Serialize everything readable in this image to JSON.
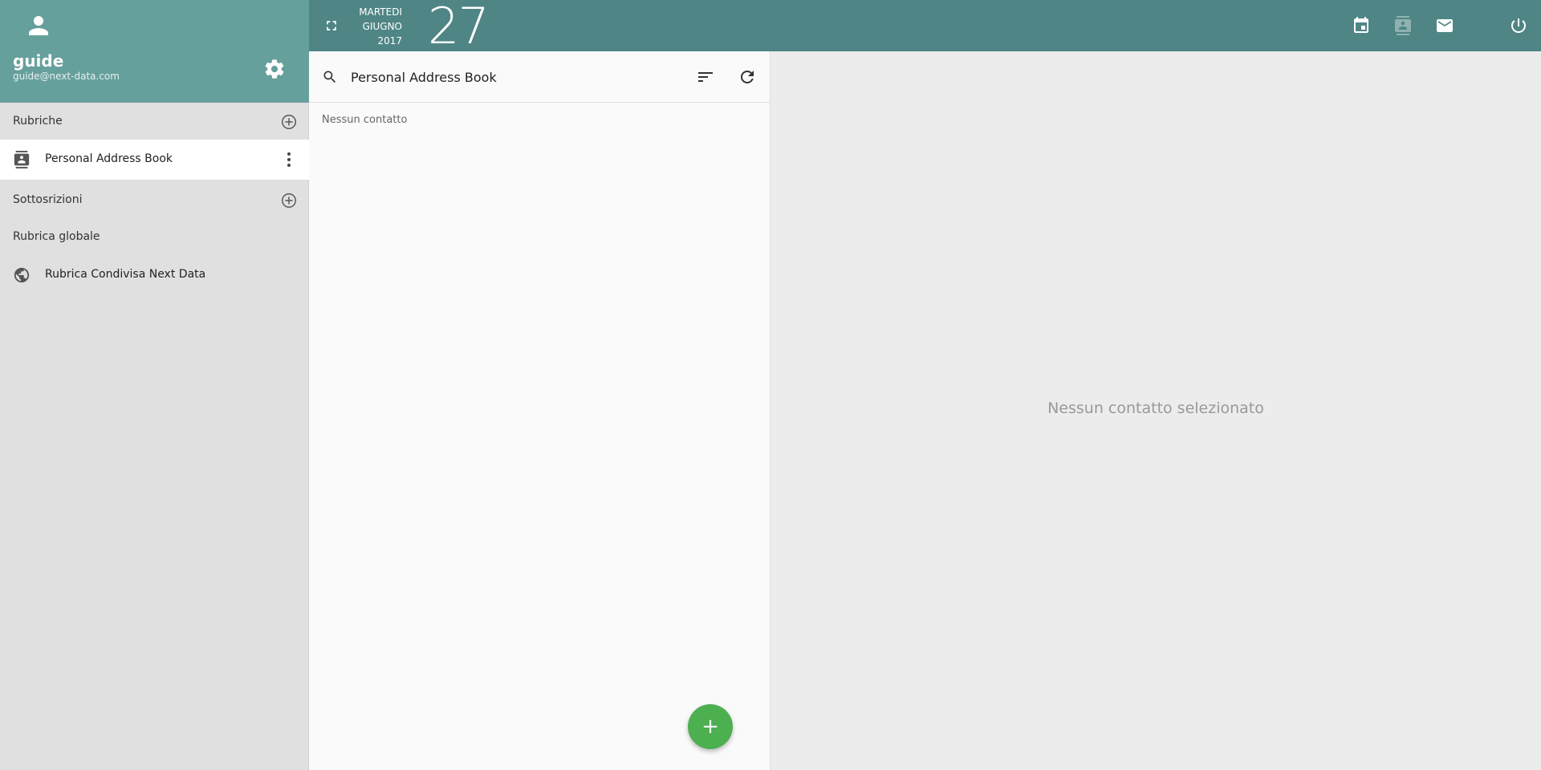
{
  "user": {
    "name": "guide",
    "email": "guide@next-data.com"
  },
  "date": {
    "weekday": "MARTEDI",
    "month": "GIUGNO",
    "year": "2017",
    "day": "27"
  },
  "sidebar": {
    "address_books_label": "Rubriche",
    "address_books": [
      {
        "label": "Personal Address Book",
        "selected": true
      }
    ],
    "subscriptions_label": "Sottosrizioni",
    "global_label": "Rubrica globale",
    "global_books": [
      {
        "label": "Rubrica Condivisa Next Data"
      }
    ]
  },
  "list": {
    "search_value": "Personal Address Book",
    "empty_text": "Nessun contatto",
    "fab_label": "+"
  },
  "detail": {
    "empty_text": "Nessun contatto selezionato"
  },
  "colors": {
    "header_bg": "#66a09c",
    "topbar_bg": "#4f8585",
    "fab": "#4caf50"
  }
}
